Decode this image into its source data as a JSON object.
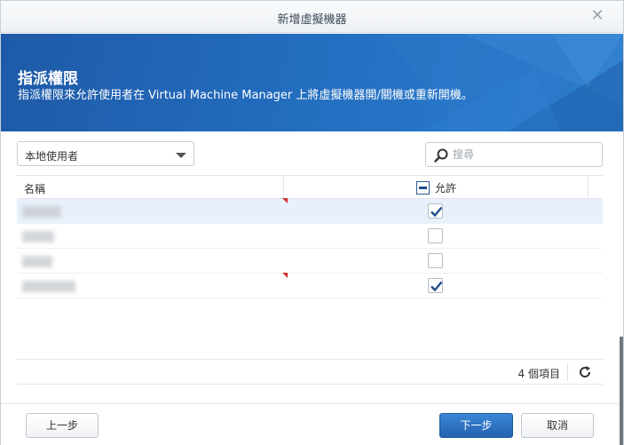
{
  "window": {
    "title": "新增虛擬機器"
  },
  "header": {
    "title": "指派權限",
    "subtitle": "指派權限來允許使用者在 Virtual Machine Manager 上將虛擬機器開/關機或重新開機。"
  },
  "toolbar": {
    "user_type_selected": "本地使用者",
    "search_placeholder": "搜尋"
  },
  "grid": {
    "columns": {
      "name": "名稱",
      "allow": "允許"
    },
    "rows": [
      {
        "allowed": true,
        "selected": true
      },
      {
        "allowed": false,
        "selected": false
      },
      {
        "allowed": false,
        "selected": false
      },
      {
        "allowed": true,
        "selected": false
      }
    ],
    "item_count": "4 個項目"
  },
  "footer": {
    "prev_label": "上一步",
    "next_label": "下一步",
    "cancel_label": "取消"
  },
  "colors": {
    "banner": "#2470c2",
    "primary_button": "#2a6fc0",
    "row_selected": "#e8f0fb"
  }
}
